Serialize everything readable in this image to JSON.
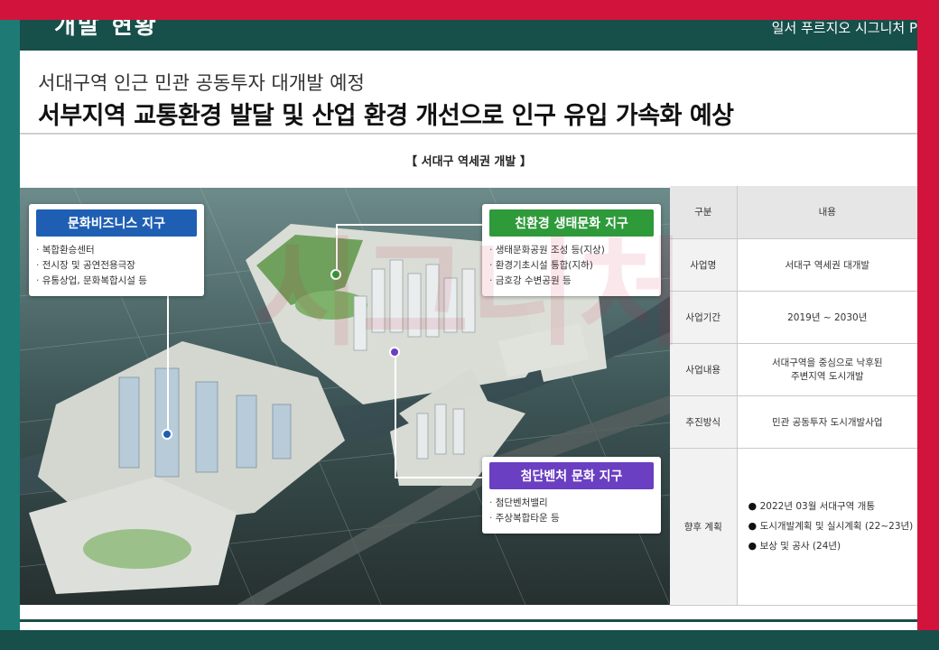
{
  "header": {
    "title": "개발 현황",
    "brand": "일서 푸르지오 시그니처 P"
  },
  "subtitle": "서대구역 인근 민관 공동투자 대개발 예정",
  "headline": "서부지역 교통환경 발달 및 산업 환경 개선으로 인구 유입 가속화 예상",
  "section_caption": "【 서대구 역세권 개발 】",
  "zones": [
    {
      "title": "문화비즈니스 지구",
      "color": "#1f5fb3",
      "items": [
        "복합환승센터",
        "전시장 및 공연전용극장",
        "유통상업, 문화복합시설 등"
      ]
    },
    {
      "title": "친환경 생태문화 지구",
      "color": "#2e9a3a",
      "items": [
        "생태문화공원 조성 등(지상)",
        "환경기초시설 통합(지하)",
        "금호강 수변공원 등"
      ]
    },
    {
      "title": "첨단벤처 문화 지구",
      "color": "#6a3fc1",
      "items": [
        "첨단벤처밸리",
        "주상복합타운 등"
      ]
    }
  ],
  "table": {
    "header": {
      "label": "구분",
      "value": "내용"
    },
    "rows": [
      {
        "label": "사업명",
        "value": "서대구 역세권 대개발"
      },
      {
        "label": "사업기간",
        "value": "2019년 ~ 2030년"
      },
      {
        "label": "사업내용",
        "value_line1": "서대구역을 중심으로 낙후된",
        "value_line2": "주변지역 도시개발"
      },
      {
        "label": "추진방식",
        "value": "민관 공동투자 도시개발사업"
      }
    ],
    "plan": {
      "label": "향후 계획",
      "items": [
        "2022년 03월 서대구역 개통",
        "도시개발계획 및 실시계획 (22~23년)",
        "보상 및 공사 (24년)"
      ]
    }
  },
  "watermark_text": "시그니처",
  "colors": {
    "frame_red": "#d2143c",
    "frame_teal": "#174f4a",
    "blue_zone": "#1f5fb3",
    "green_zone": "#2e9a3a",
    "purple_zone": "#6a3fc1"
  }
}
